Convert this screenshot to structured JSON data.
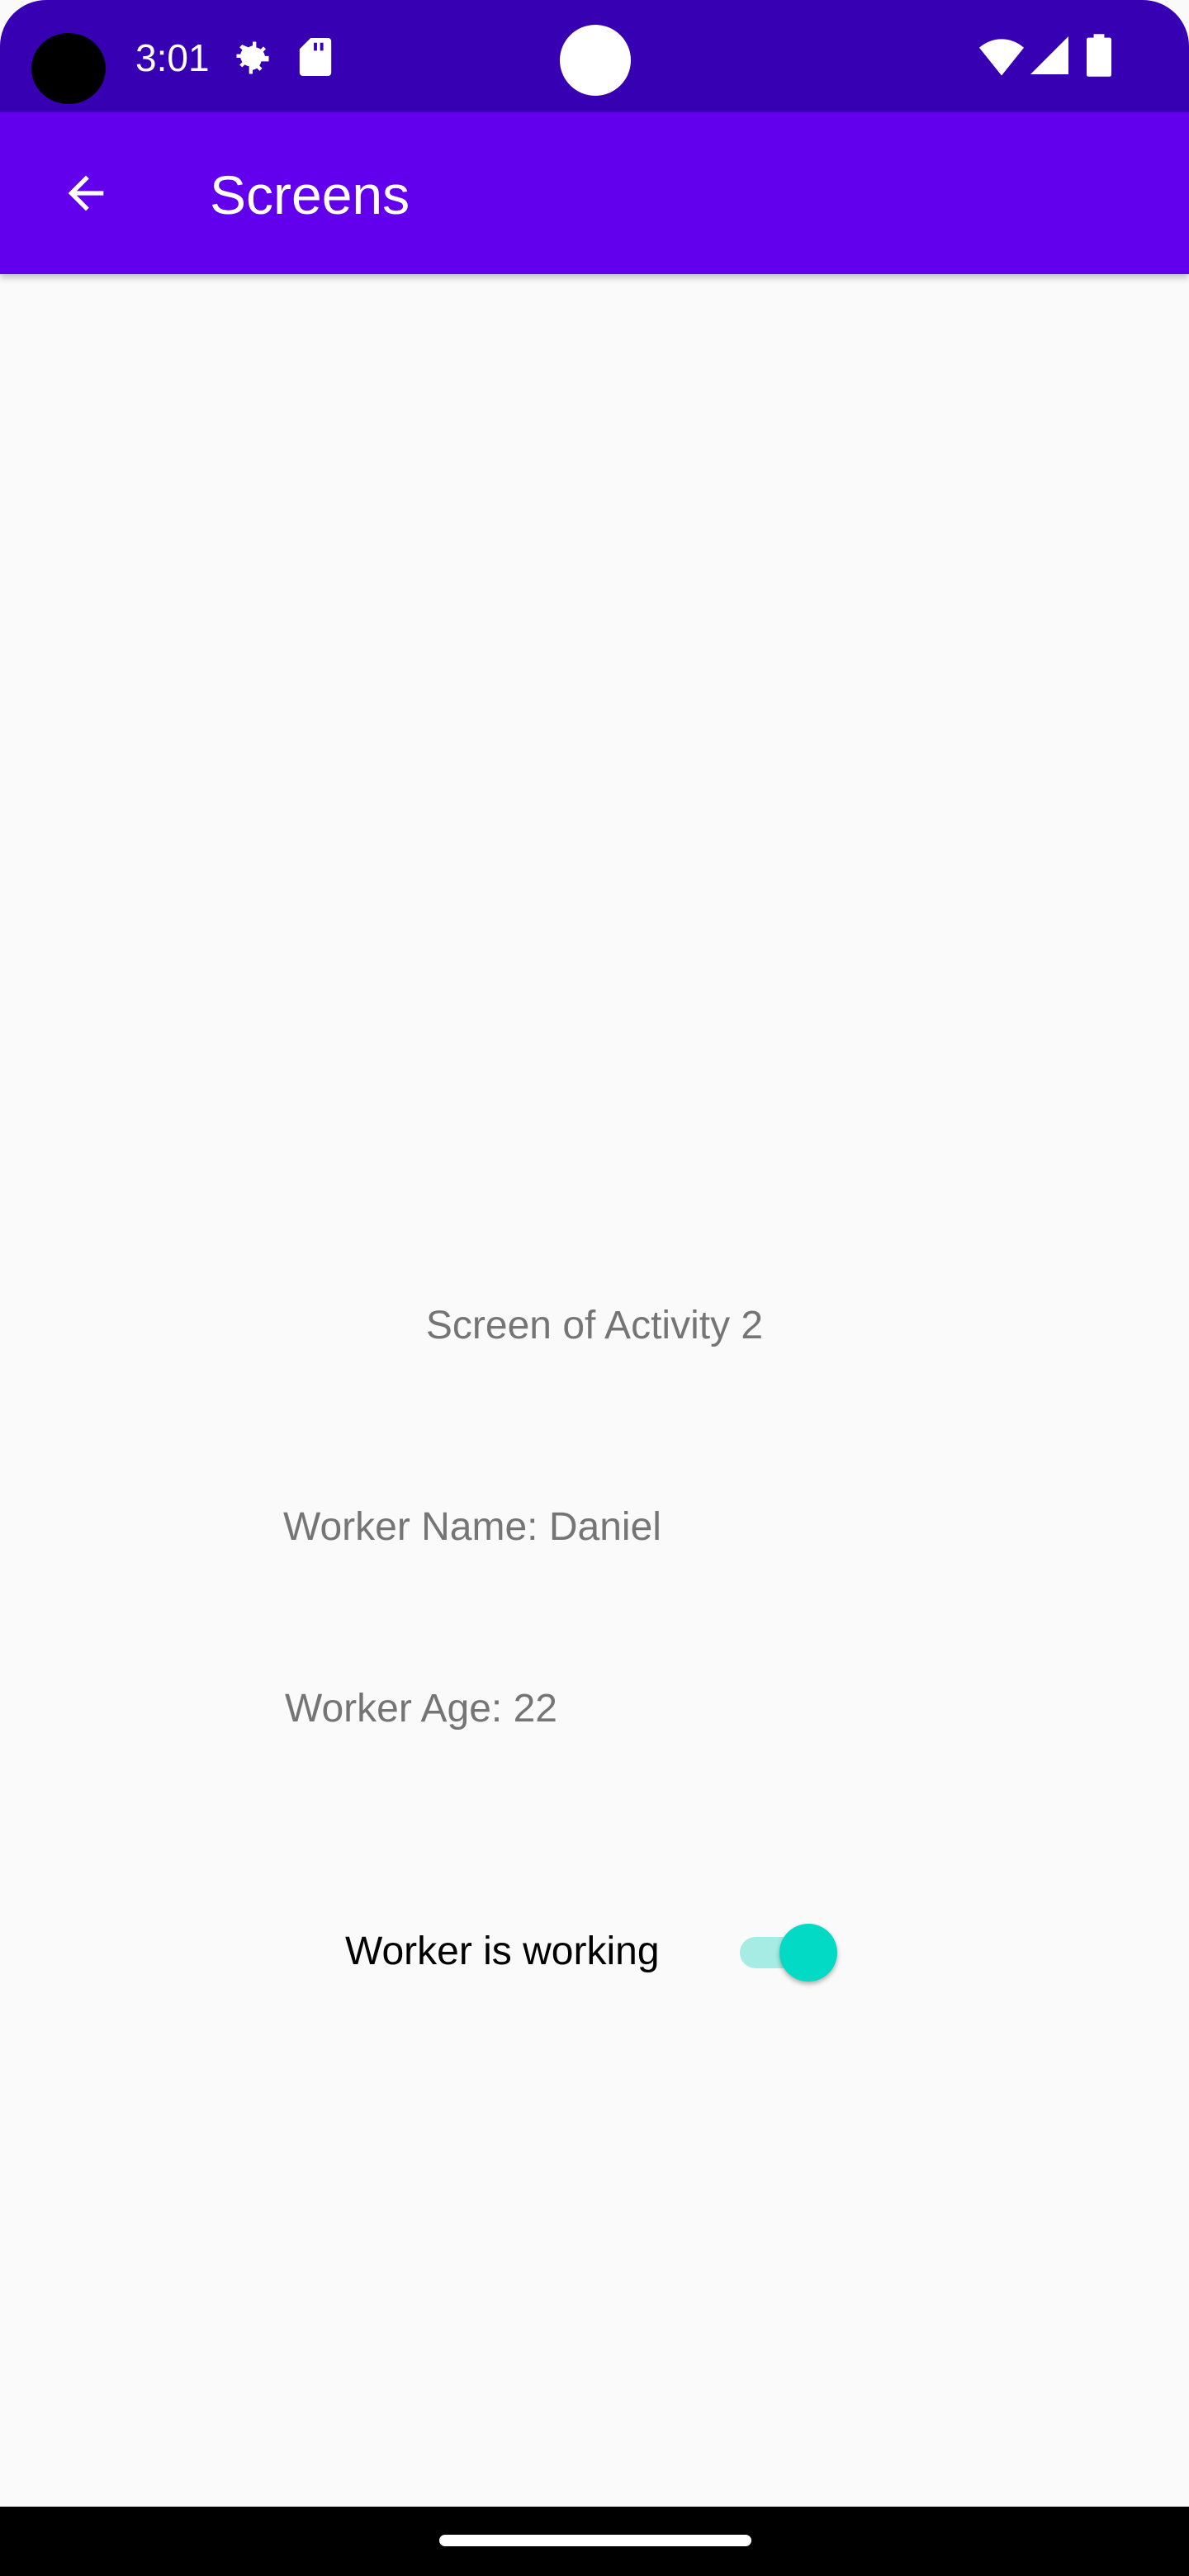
{
  "status_bar": {
    "time": "3:01",
    "icons": [
      "gear-icon",
      "sd-card-icon",
      "wifi-icon",
      "signal-icon",
      "battery-icon"
    ]
  },
  "app_bar": {
    "title": "Screens",
    "back_icon": "arrow-back-icon"
  },
  "content": {
    "screen_label": "Screen of Activity 2",
    "worker_name": "Worker Name: Daniel",
    "worker_age": "Worker Age: 22",
    "working_switch": {
      "label": "Worker is working",
      "checked": true
    }
  },
  "colors": {
    "status_bar": "#3700b3",
    "app_bar": "#6200ee",
    "accent": "#03dac5",
    "background": "#fafafa"
  }
}
